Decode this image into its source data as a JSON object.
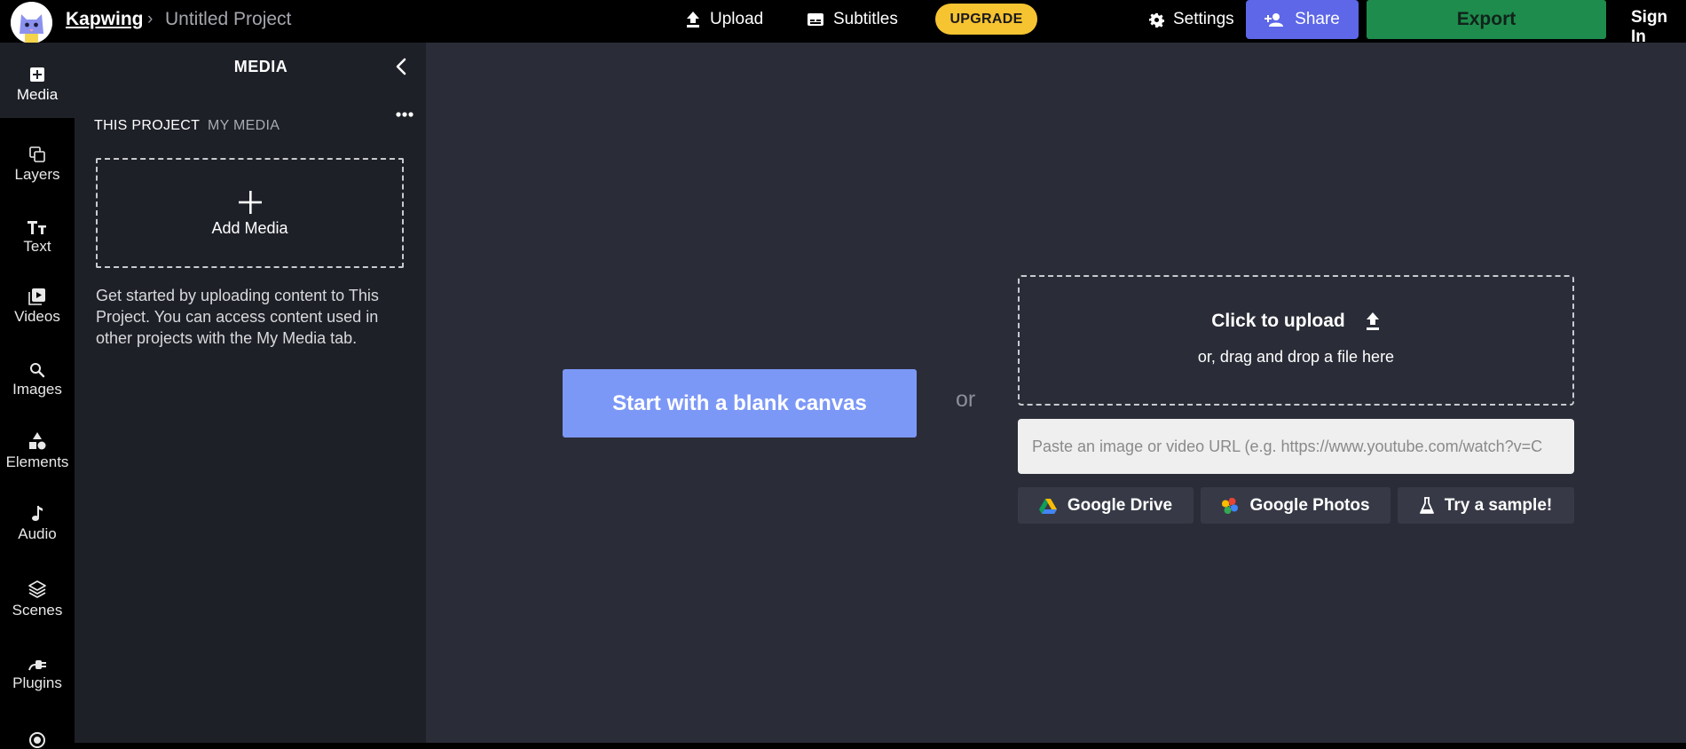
{
  "header": {
    "brand": "Kapwing",
    "crumb_separator": "›",
    "project_title": "Untitled Project",
    "upload_label": "Upload",
    "subtitles_label": "Subtitles",
    "upgrade_label": "UPGRADE",
    "settings_label": "Settings",
    "share_label": "Share",
    "export_label": "Export",
    "signin_label": "Sign In"
  },
  "rail": {
    "items": [
      {
        "label": "Media",
        "icon": "add-media-icon"
      },
      {
        "label": "Layers",
        "icon": "layers-icon"
      },
      {
        "label": "Text",
        "icon": "text-icon"
      },
      {
        "label": "Videos",
        "icon": "videos-icon"
      },
      {
        "label": "Images",
        "icon": "search-icon"
      },
      {
        "label": "Elements",
        "icon": "shapes-icon"
      },
      {
        "label": "Audio",
        "icon": "music-note-icon"
      },
      {
        "label": "Scenes",
        "icon": "stack-icon"
      },
      {
        "label": "Plugins",
        "icon": "plug-icon"
      }
    ]
  },
  "panel": {
    "title": "MEDIA",
    "tabs": [
      "THIS PROJECT",
      "MY MEDIA"
    ],
    "add_media_label": "Add Media",
    "help_text": "Get started by uploading content to This Project. You can access content used in other projects with the My Media tab."
  },
  "main": {
    "blank_canvas_label": "Start with a blank canvas",
    "or_label": "or",
    "upload_title": "Click to upload",
    "upload_subtitle": "or, drag and drop a file here",
    "url_placeholder": "Paste an image or video URL (e.g. https://www.youtube.com/watch?v=C",
    "sources": [
      {
        "label": "Google Drive",
        "icon": "google-drive-icon"
      },
      {
        "label": "Google Photos",
        "icon": "google-photos-icon"
      },
      {
        "label": "Try a sample!",
        "icon": "flask-icon"
      }
    ]
  },
  "colors": {
    "upgrade": "#f7c431",
    "share": "#5d67e8",
    "export": "#1e8c4d",
    "blank_canvas": "#7c98f7",
    "panel_bg": "#1e2028",
    "main_bg": "#2a2d38"
  }
}
